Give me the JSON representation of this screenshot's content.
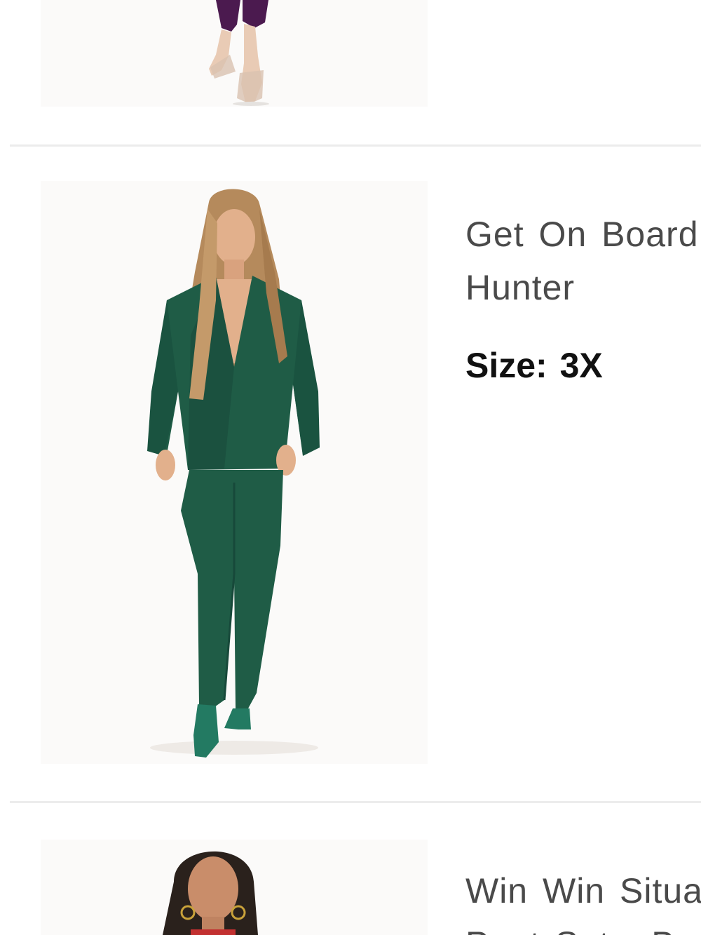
{
  "items": [
    {
      "image_alt": "Purple pants with clear heels",
      "colors": {
        "garment": "#4b1a4f",
        "shoes": "#e9d6c8"
      }
    },
    {
      "title_line1": "Get On Board",
      "title_line2": "Hunter",
      "size_label": "Size:",
      "size_value": "3X",
      "colors": {
        "garment": "#1f5c46",
        "garment_dark": "#17493a",
        "hair": "#b58a5c",
        "skin": "#e2b08c"
      }
    },
    {
      "title_line1": "Win Win Situa",
      "title_line2": "Pant Set - B",
      "colors": {
        "hair": "#2a211c",
        "skin": "#c98d6a",
        "accent": "#c23030"
      }
    }
  ]
}
